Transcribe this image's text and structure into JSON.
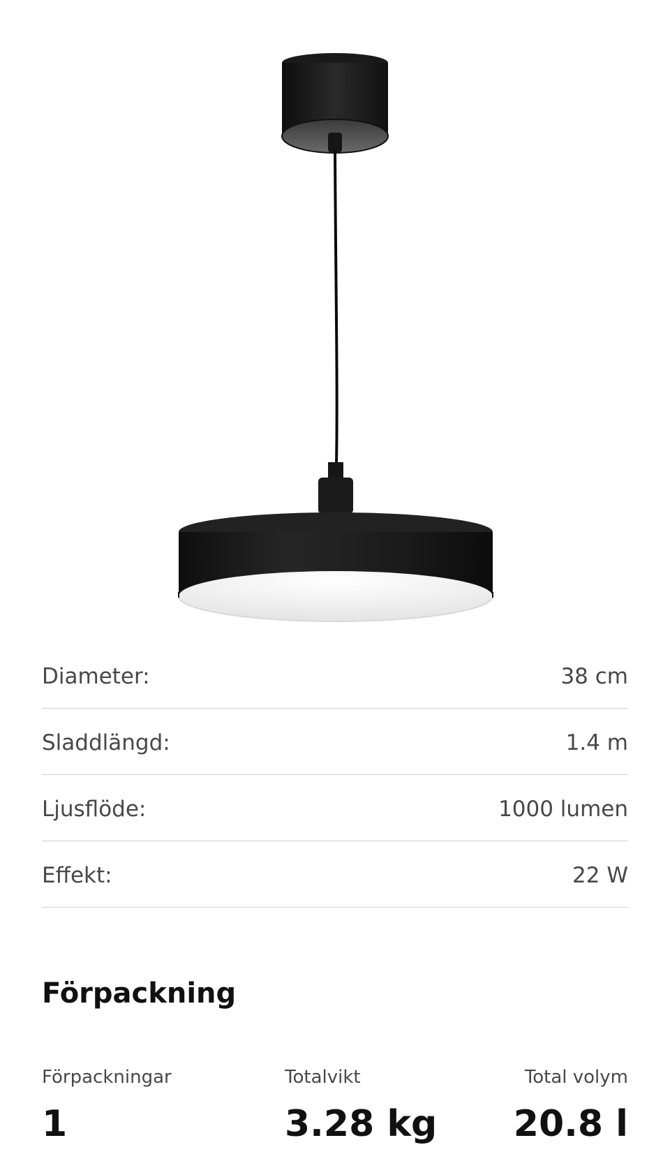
{
  "product_image": {
    "icon": "pendant-lamp-icon",
    "colors": {
      "lamp_body": "#1c1c1c",
      "diffuser": "#f2f2f2",
      "background": "#ffffff"
    }
  },
  "specs": [
    {
      "label": "Diameter:",
      "value": "38 cm"
    },
    {
      "label": "Sladdlängd:",
      "value": "1.4 m"
    },
    {
      "label": "Ljusflöde:",
      "value": "1000 lumen"
    },
    {
      "label": "Effekt:",
      "value": "22 W"
    }
  ],
  "packaging": {
    "title": "Förpackning",
    "count_label": "Förpackningar",
    "count_value": "1",
    "weight_label": "Totalvikt",
    "weight_value": "3.28 kg",
    "volume_label": "Total volym",
    "volume_value": "20.8 l"
  }
}
